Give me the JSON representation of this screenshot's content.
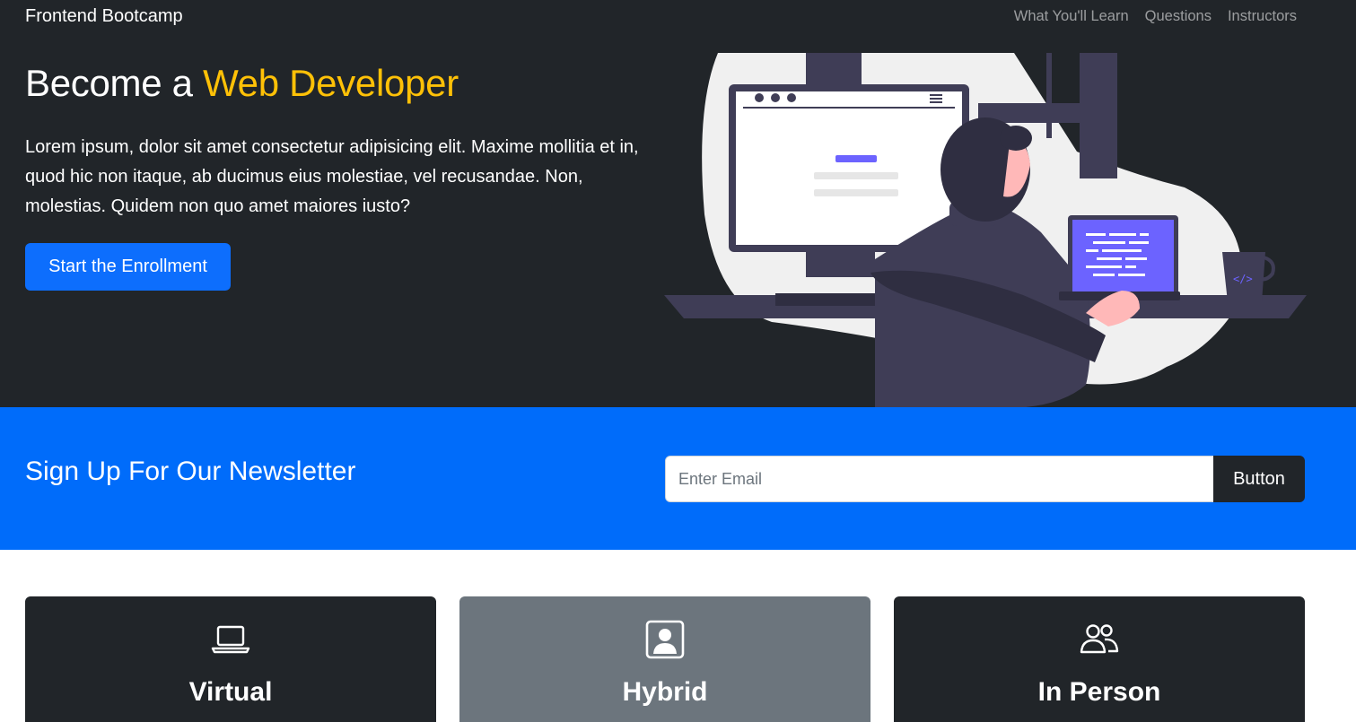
{
  "navbar": {
    "brand": "Frontend Bootcamp",
    "links": [
      {
        "label": "What You'll Learn"
      },
      {
        "label": "Questions"
      },
      {
        "label": "Instructors"
      }
    ]
  },
  "hero": {
    "title_prefix": "Become a ",
    "title_accent": "Web Developer",
    "text": "Lorem ipsum, dolor sit amet consectetur adipisicing elit. Maxime mollitia et in, quod hic non itaque, ab ducimus eius molestiae, vel recusandae. Non, molestias. Quidem non quo amet maiores iusto?",
    "button_label": "Start the Enrollment",
    "illustration": "developer-at-desk-illustration",
    "accent_color": "#ffc107"
  },
  "newsletter": {
    "title": "Sign Up For Our Newsletter",
    "email_placeholder": "Enter Email",
    "email_value": "",
    "button_label": "Button",
    "background_color": "#006cfa"
  },
  "cards": [
    {
      "title": "Virtual",
      "icon": "laptop-icon",
      "style": "dark"
    },
    {
      "title": "Hybrid",
      "icon": "person-square-icon",
      "style": "gray"
    },
    {
      "title": "In Person",
      "icon": "people-icon",
      "style": "dark"
    }
  ]
}
